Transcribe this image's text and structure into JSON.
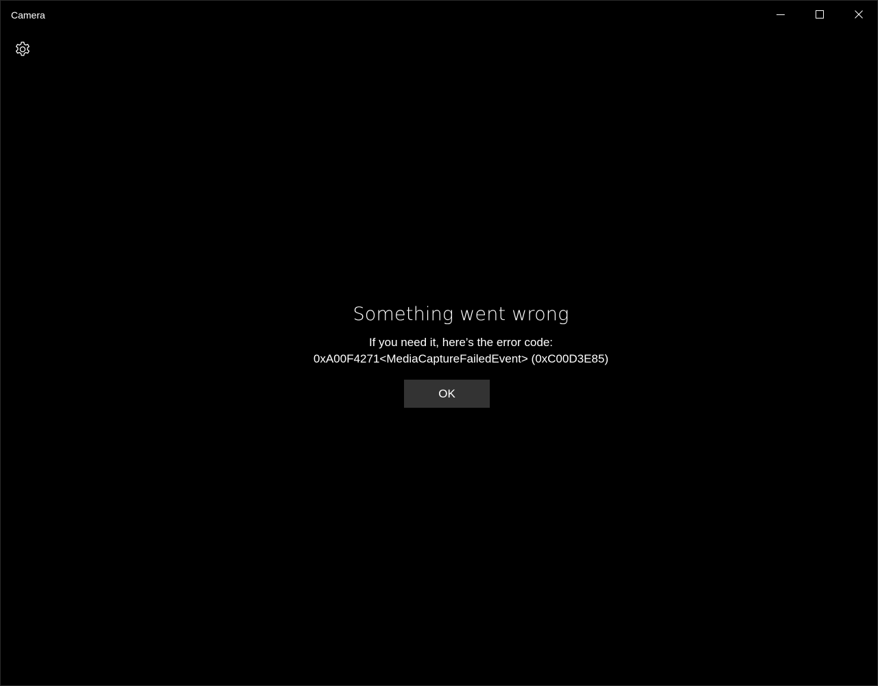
{
  "window": {
    "title": "Camera"
  },
  "titlebar": {
    "minimize_icon": "minimize-icon",
    "maximize_icon": "maximize-icon",
    "close_icon": "close-icon"
  },
  "toolbar": {
    "settings_icon": "gear-icon"
  },
  "error": {
    "title": "Something went wrong",
    "message": "If you need it, here’s the error code:",
    "code": "0xA00F4271<MediaCaptureFailedEvent> (0xC00D3E85)",
    "ok_label": "OK"
  },
  "colors": {
    "background": "#000000",
    "text": "#ffffff",
    "button_background": "#333333"
  }
}
